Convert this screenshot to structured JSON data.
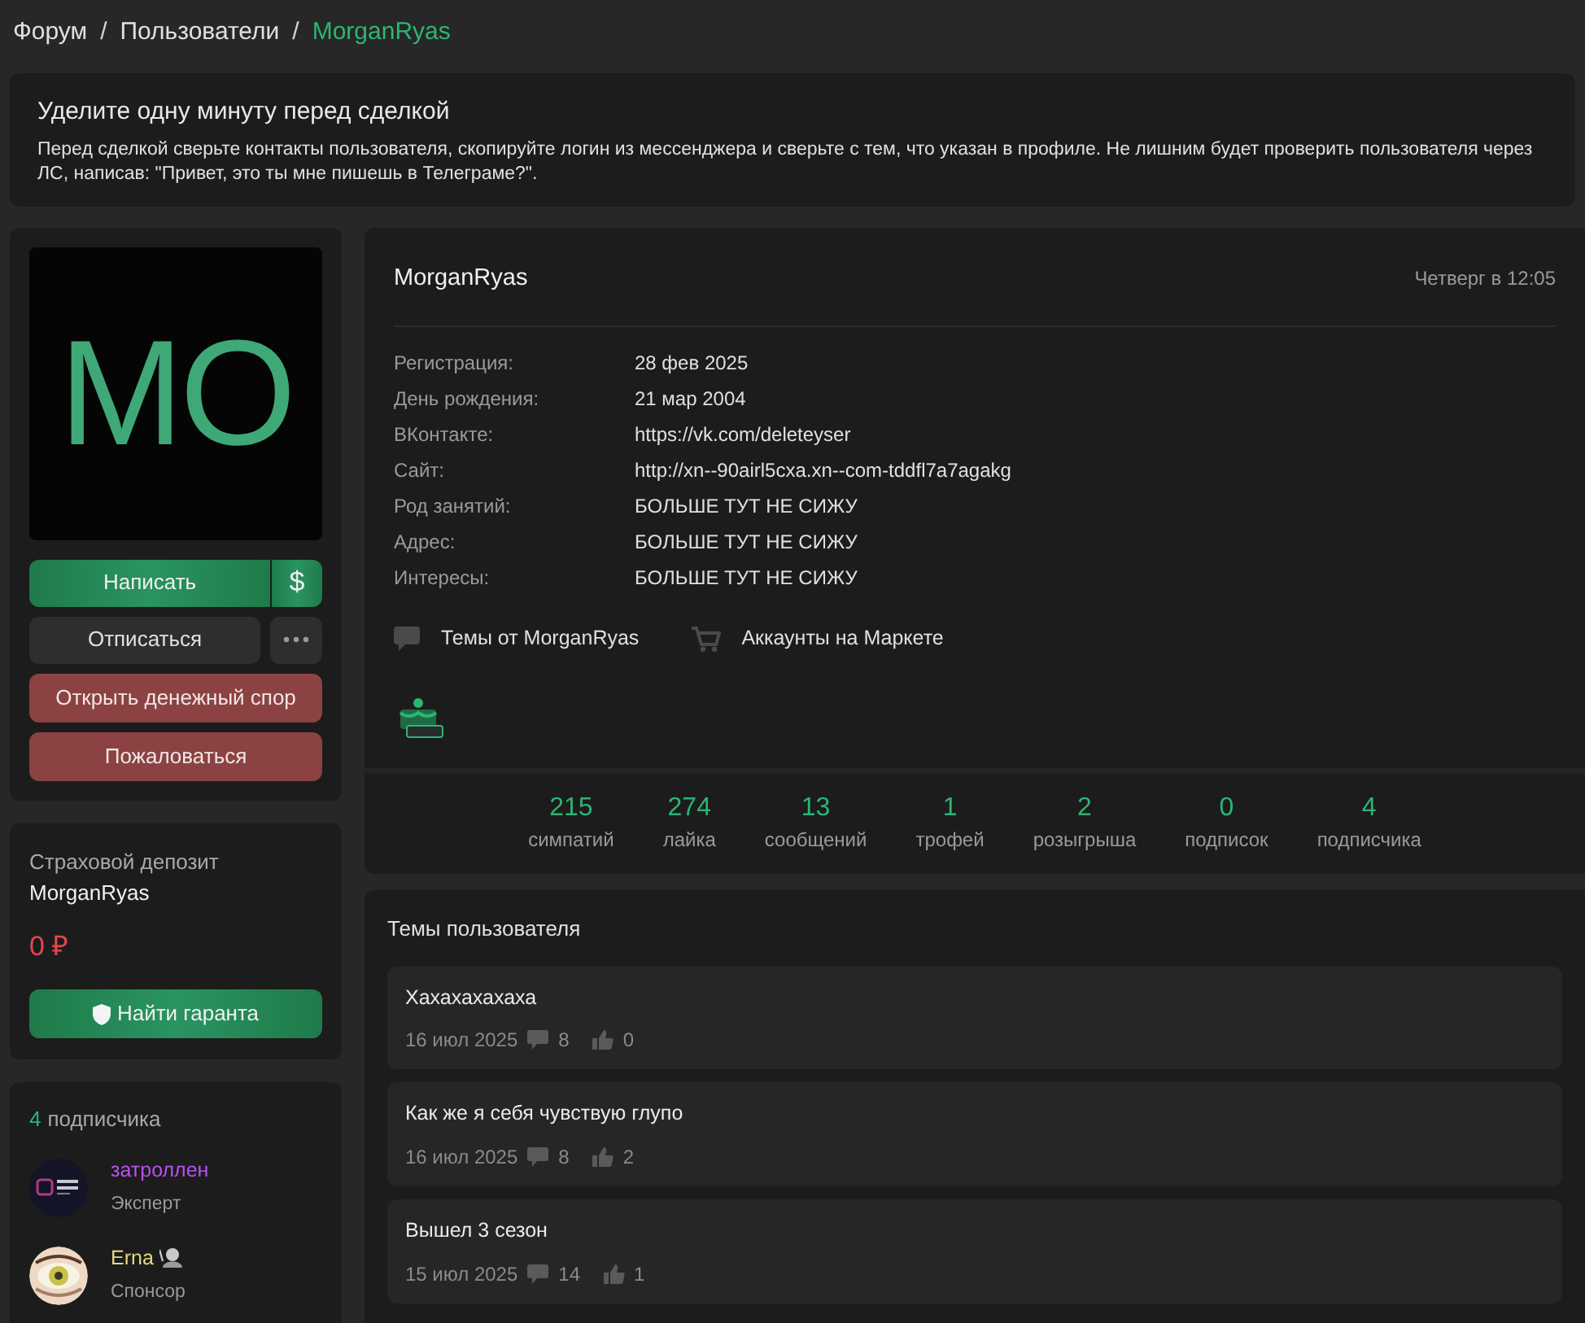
{
  "breadcrumbs": [
    {
      "label": "Форум",
      "current": false
    },
    {
      "separator": "/",
      "label": "Пользователи",
      "current": false
    },
    {
      "separator": "/",
      "label": "MorganRyas",
      "current": true
    }
  ],
  "notice": {
    "title": "Уделите одну минуту перед сделкой",
    "text": "Перед сделкой сверьте контакты пользователя, скопируйте логин из мессенджера и сверьте с тем, что указан в профиле. Не лишним будет проверить пользователя через ЛС, написав: \"Привет, это ты мне пишешь в Телеграме?\"."
  },
  "avatar": {
    "initials": "MO"
  },
  "actions": [
    {
      "label": "Написать",
      "kind": "primary",
      "side": "$"
    },
    {
      "label": "Отписаться",
      "kind": "secondary",
      "more_menu": true
    },
    {
      "label": "Открыть денежный спор",
      "kind": "danger"
    },
    {
      "label": "Пожаловаться",
      "kind": "danger"
    }
  ],
  "deposit": {
    "title": "Страховой депозит",
    "user": "MorganRyas",
    "amount": "0 ₽",
    "button": "Найти гаранта"
  },
  "followers": {
    "count": "4",
    "label": "подписчика",
    "items": [
      {
        "name": "затроллен",
        "role": "Эксперт",
        "color": "#b94ff0",
        "emoji": false
      },
      {
        "name": "Erna",
        "role": "Спонсор",
        "color": "#e6d87c",
        "emoji": true
      }
    ]
  },
  "profile": {
    "name": "MorganRyas",
    "last_seen": "Четверг в 12:05",
    "fields": [
      {
        "label": "Регистрация:",
        "value": "28 фев 2025"
      },
      {
        "label": "День рождения:",
        "value": "21 мар 2004"
      },
      {
        "label": "ВКонтакте:",
        "value": "https://vk.com/deleteyser"
      },
      {
        "label": "Сайт:",
        "value": "http://xn--90airl5cxa.xn--com-tddfl7a7agakg"
      },
      {
        "label": "Род занятий:",
        "value": "БОЛЬШЕ ТУТ НЕ СИЖУ"
      },
      {
        "label": "Адрес:",
        "value": "БОЛЬШЕ ТУТ НЕ СИЖУ"
      },
      {
        "label": "Интересы:",
        "value": "БОЛЬШЕ ТУТ НЕ СИЖУ"
      }
    ],
    "links": [
      {
        "label": "Темы от MorganRyas",
        "kind": "topics"
      },
      {
        "label": "Аккаунты на Маркете",
        "kind": "market"
      }
    ],
    "stats": [
      {
        "value": "215",
        "label": "симпатий"
      },
      {
        "value": "274",
        "label": "лайка"
      },
      {
        "value": "13",
        "label": "сообщений"
      },
      {
        "value": "1",
        "label": "трофей"
      },
      {
        "value": "2",
        "label": "розыгрыша"
      },
      {
        "value": "0",
        "label": "подписок"
      },
      {
        "value": "4",
        "label": "подписчика"
      }
    ]
  },
  "topics": {
    "title": "Темы пользователя",
    "items": [
      {
        "title": "Хахахахахаха",
        "date": "16 июл 2025",
        "replies": "8",
        "likes": "0"
      },
      {
        "title": "Как же я себя чувствую глупо",
        "date": "16 июл 2025",
        "replies": "8",
        "likes": "2"
      },
      {
        "title": "Вышел 3 сезон",
        "date": "15 июл 2025",
        "replies": "14",
        "likes": "1"
      }
    ]
  }
}
